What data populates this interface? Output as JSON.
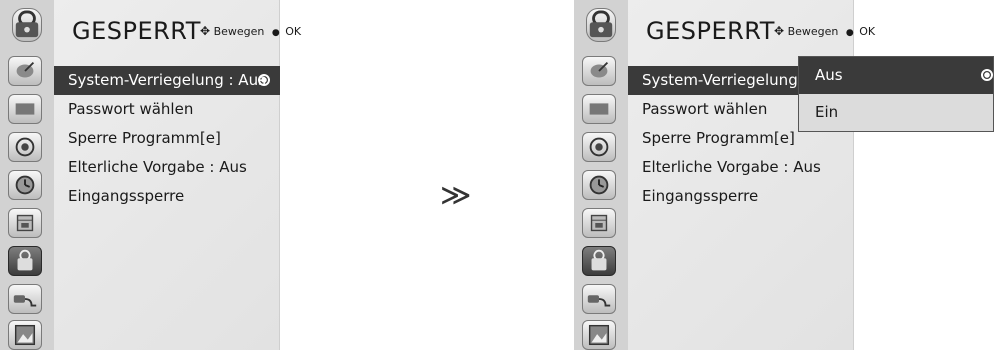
{
  "left": {
    "title": "GESPERRT",
    "hint_move": "Bewegen",
    "hint_ok": "OK",
    "menu": [
      {
        "label": "System-Verriegelung : Aus"
      },
      {
        "label": "Passwort wählen"
      },
      {
        "label": "Sperre Programm[e]"
      },
      {
        "label": "Elterliche Vorgabe  : Aus"
      },
      {
        "label": "Eingangssperre"
      }
    ]
  },
  "arrow": "≫",
  "right": {
    "title": "GESPERRT",
    "hint_move": "Bewegen",
    "hint_ok": "OK",
    "menu": [
      {
        "label": "System-Verriegelung"
      },
      {
        "label": "Passwort wählen"
      },
      {
        "label": "Sperre Programm[e]"
      },
      {
        "label": "Elterliche Vorgabe  : Aus"
      },
      {
        "label": "Eingangssperre"
      }
    ],
    "popup": [
      {
        "label": "Aus"
      },
      {
        "label": "Ein"
      }
    ]
  },
  "icons": [
    "satellite-dish-icon",
    "tv-screen-icon",
    "speaker-icon",
    "clock-icon",
    "calendar-icon",
    "padlock-icon",
    "input-cable-icon",
    "photo-frame-icon"
  ]
}
